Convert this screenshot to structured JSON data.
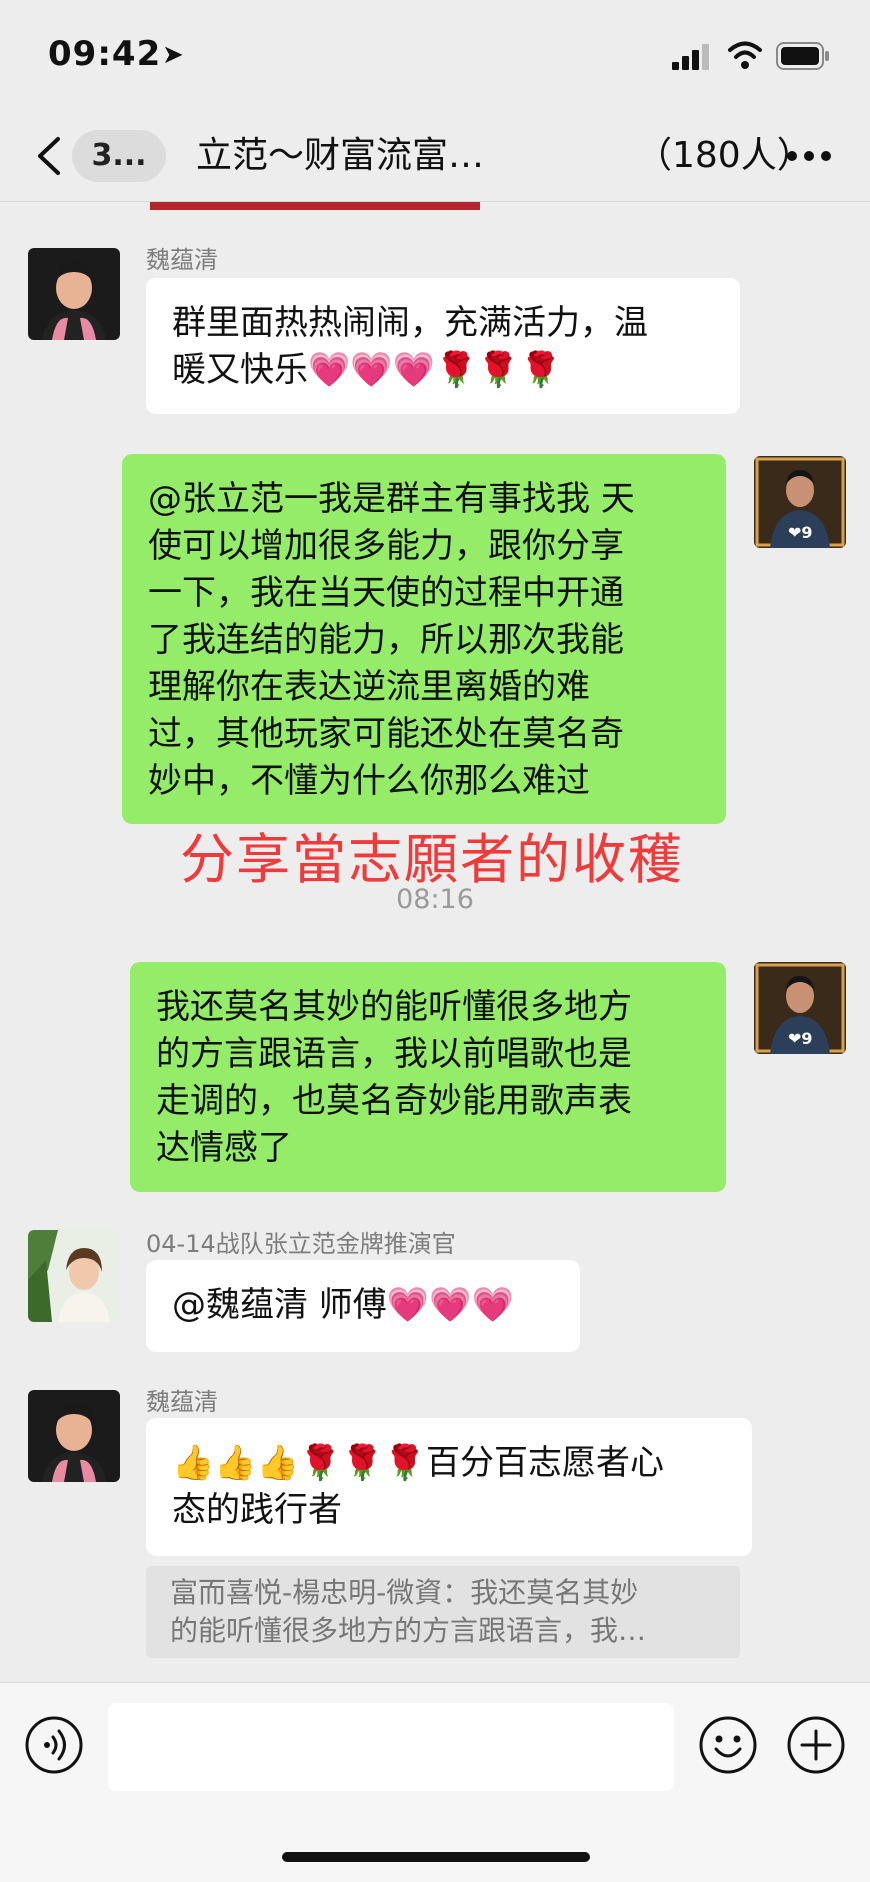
{
  "status_bar": {
    "time": "09:42",
    "location_icon": "location-arrow-icon",
    "signal_icon": "cellular-signal-icon",
    "wifi_icon": "wifi-icon",
    "battery_icon": "battery-icon"
  },
  "nav": {
    "back_icon": "chevron-left-icon",
    "unread_badge": "3...",
    "title": "立范～财富流富…",
    "member_count": "（180人）",
    "more_icon": "more-dots-icon"
  },
  "messages": [
    {
      "sender": "魏蕴清",
      "side": "left",
      "text_lines": [
        "群里面热热闹闹，充满活力，温",
        "暖又快乐💗💗💗🌹🌹🌹"
      ]
    },
    {
      "sender": "",
      "side": "right",
      "text_lines": [
        "@张立范一我是群主有事找我 天",
        "使可以增加很多能力，跟你分享",
        "一下，我在当天使的过程中开通",
        "了我连结的能力，所以那次我能",
        "理解你在表达逆流里离婚的难",
        "过，其他玩家可能还处在莫名奇",
        "妙中，不懂为什么你那么难过"
      ]
    },
    {
      "sender": "",
      "side": "right",
      "text_lines": [
        "我还莫名其妙的能听懂很多地方",
        "的方言跟语言，我以前唱歌也是",
        "走调的，也莫名奇妙能用歌声表",
        "达情感了"
      ]
    },
    {
      "sender": "04-14战队张立范金牌推演官",
      "side": "left",
      "text_lines": [
        "@魏蕴清 师傅💗💗💗"
      ]
    },
    {
      "sender": "魏蕴清",
      "side": "left",
      "text_lines": [
        "👍👍👍🌹🌹🌹百分百志愿者心",
        "态的践行者"
      ]
    }
  ],
  "overlay_caption": "分享當志願者的收穫",
  "timestamp": "08:16",
  "quote": {
    "lines": [
      "富而喜悦-楊忠明-微資：我还莫名其妙",
      "的能听懂很多地方的方言跟语言，我…"
    ]
  },
  "input_bar": {
    "voice_icon": "voice-icon",
    "emoji_icon": "emoji-icon",
    "plus_icon": "plus-icon",
    "placeholder": ""
  },
  "colors": {
    "background": "#ededed",
    "green_bubble": "#95ec69",
    "white_bubble": "#ffffff",
    "caption_red": "#ef3b3b"
  }
}
